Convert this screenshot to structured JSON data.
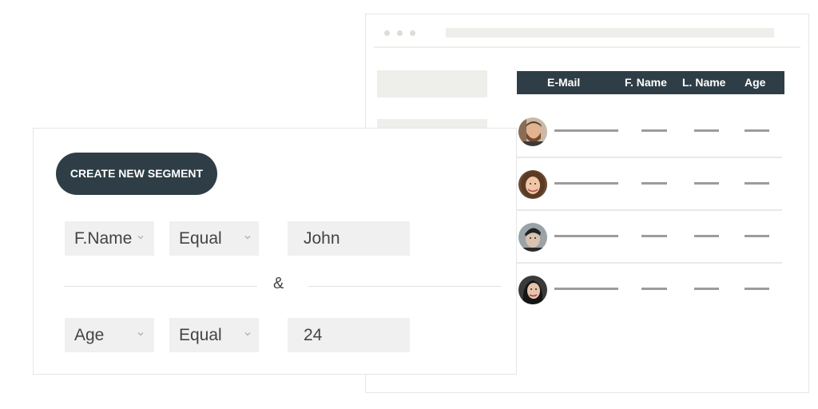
{
  "table": {
    "headers": [
      "E-Mail",
      "F. Name",
      "L. Name",
      "Age"
    ],
    "rows": [
      {
        "avatar": "avatar-man-beard"
      },
      {
        "avatar": "avatar-woman-curly-hair"
      },
      {
        "avatar": "avatar-man-dark-hair"
      },
      {
        "avatar": "avatar-woman-dark-hair"
      }
    ]
  },
  "segment": {
    "create_label": "CREATE NEW SEGMENT",
    "connector": "&",
    "conditions": [
      {
        "field": "F.Name",
        "operator": "Equal",
        "value": "John"
      },
      {
        "field": "Age",
        "operator": "Equal",
        "value": "24"
      }
    ]
  },
  "colors": {
    "accent": "#2f3e46",
    "placeholder": "#eeeeea",
    "field_bg": "#f0f0f0"
  },
  "icons": [
    "chevron-down-icon",
    "browser-dot-icon"
  ]
}
